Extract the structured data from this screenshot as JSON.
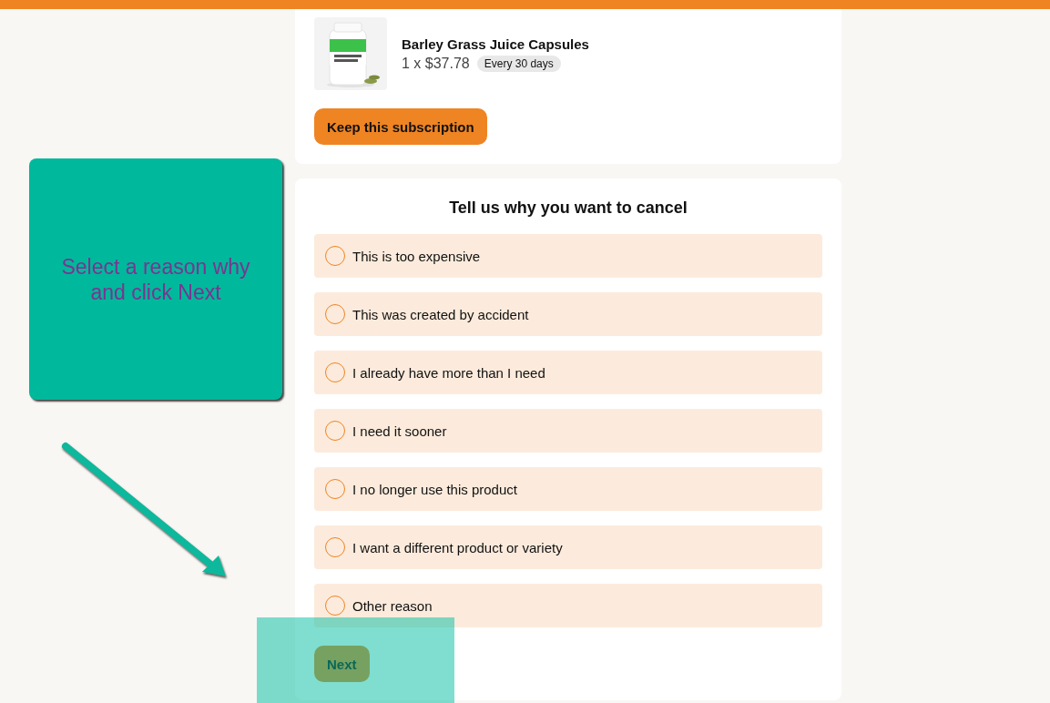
{
  "product": {
    "name": "Barley Grass Juice Capsules",
    "price": "1 x $37.78",
    "frequency": "Every 30 days"
  },
  "keep_button": "Keep this subscription",
  "survey": {
    "title": "Tell us why you want to cancel",
    "options": [
      {
        "label": "This is too expensive",
        "selected": false
      },
      {
        "label": "This was created by accident",
        "selected": false
      },
      {
        "label": "I already have more than I need",
        "selected": false
      },
      {
        "label": "I need it sooner",
        "selected": false
      },
      {
        "label": "I no longer use this product",
        "selected": false
      },
      {
        "label": "I want a different product or variety",
        "selected": false
      },
      {
        "label": "Other reason",
        "selected": false
      }
    ],
    "next_button": "Next"
  },
  "callout": {
    "text": "Select a reason why and click Next"
  }
}
